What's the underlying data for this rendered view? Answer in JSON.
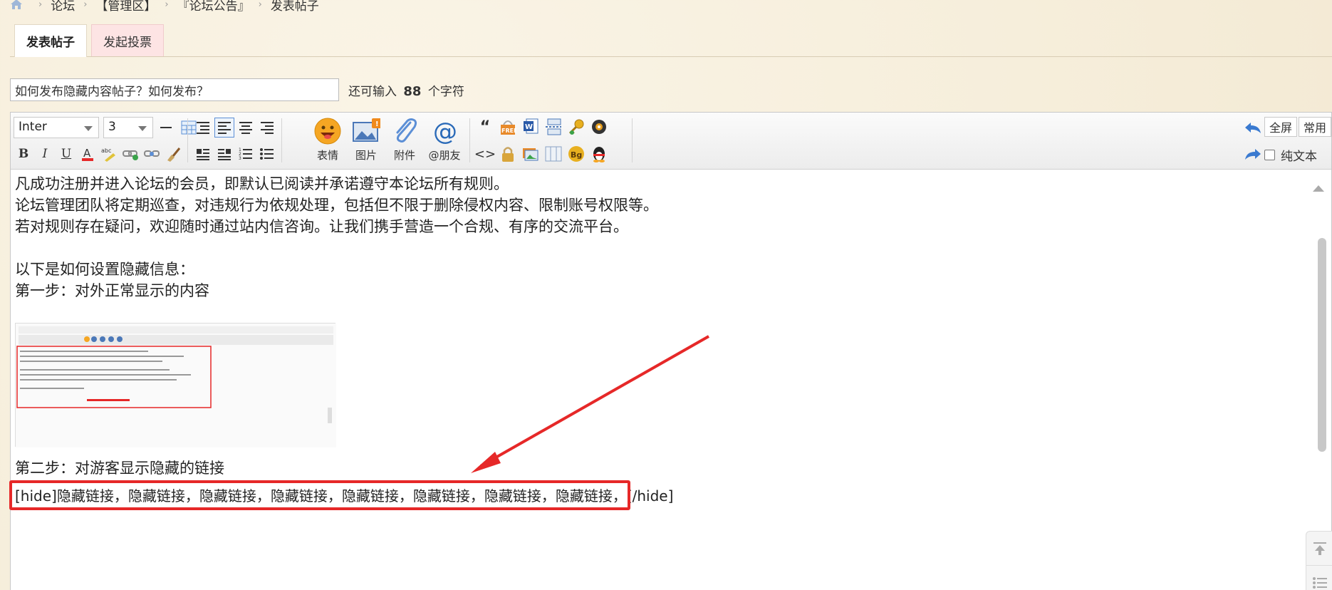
{
  "breadcrumb": {
    "items": [
      "论坛",
      "【管理区】",
      "『论坛公告』",
      "发表帖子"
    ],
    "separator": "›"
  },
  "tabs": [
    {
      "label": "发表帖子",
      "active": true
    },
    {
      "label": "发起投票",
      "active": false
    }
  ],
  "subject": {
    "value": "如何发布隐藏内容帖子？如何发布？",
    "remain_prefix": "还可输入",
    "remain_count": "88",
    "remain_suffix": "个字符"
  },
  "toolbar": {
    "font": "Inter",
    "size": "3",
    "emoji_label": "表情",
    "image_label": "图片",
    "attach_label": "附件",
    "at_label": "@朋友",
    "fullscreen_label": "全屏",
    "common_label": "常用",
    "plain_label": "纯文本"
  },
  "content": {
    "lines": [
      "凡成功注册并进入论坛的会员，即默认已阅读并承诺遵守本论坛所有规则。",
      "论坛管理团队将定期巡查，对违规行为依规处理，包括但不限于删除侵权内容、限制账号权限等。",
      "若对规则存在疑问，欢迎随时通过站内信咨询。让我们携手营造一个合规、有序的交流平台。",
      "",
      "以下是如何设置隐藏信息：",
      "第一步：对外正常显示的内容"
    ],
    "step2": "第二步：对游客显示隐藏的链接",
    "hide_line": "[hide]隐藏链接，隐藏链接，隐藏链接，隐藏链接，隐藏链接，隐藏链接，隐藏链接，隐藏链接，[/hide]"
  },
  "colors": {
    "highlight": "#e62828",
    "background": "#f8f1e0",
    "active_tab": "#ffffff",
    "inactive_tab": "#fde4e4"
  }
}
